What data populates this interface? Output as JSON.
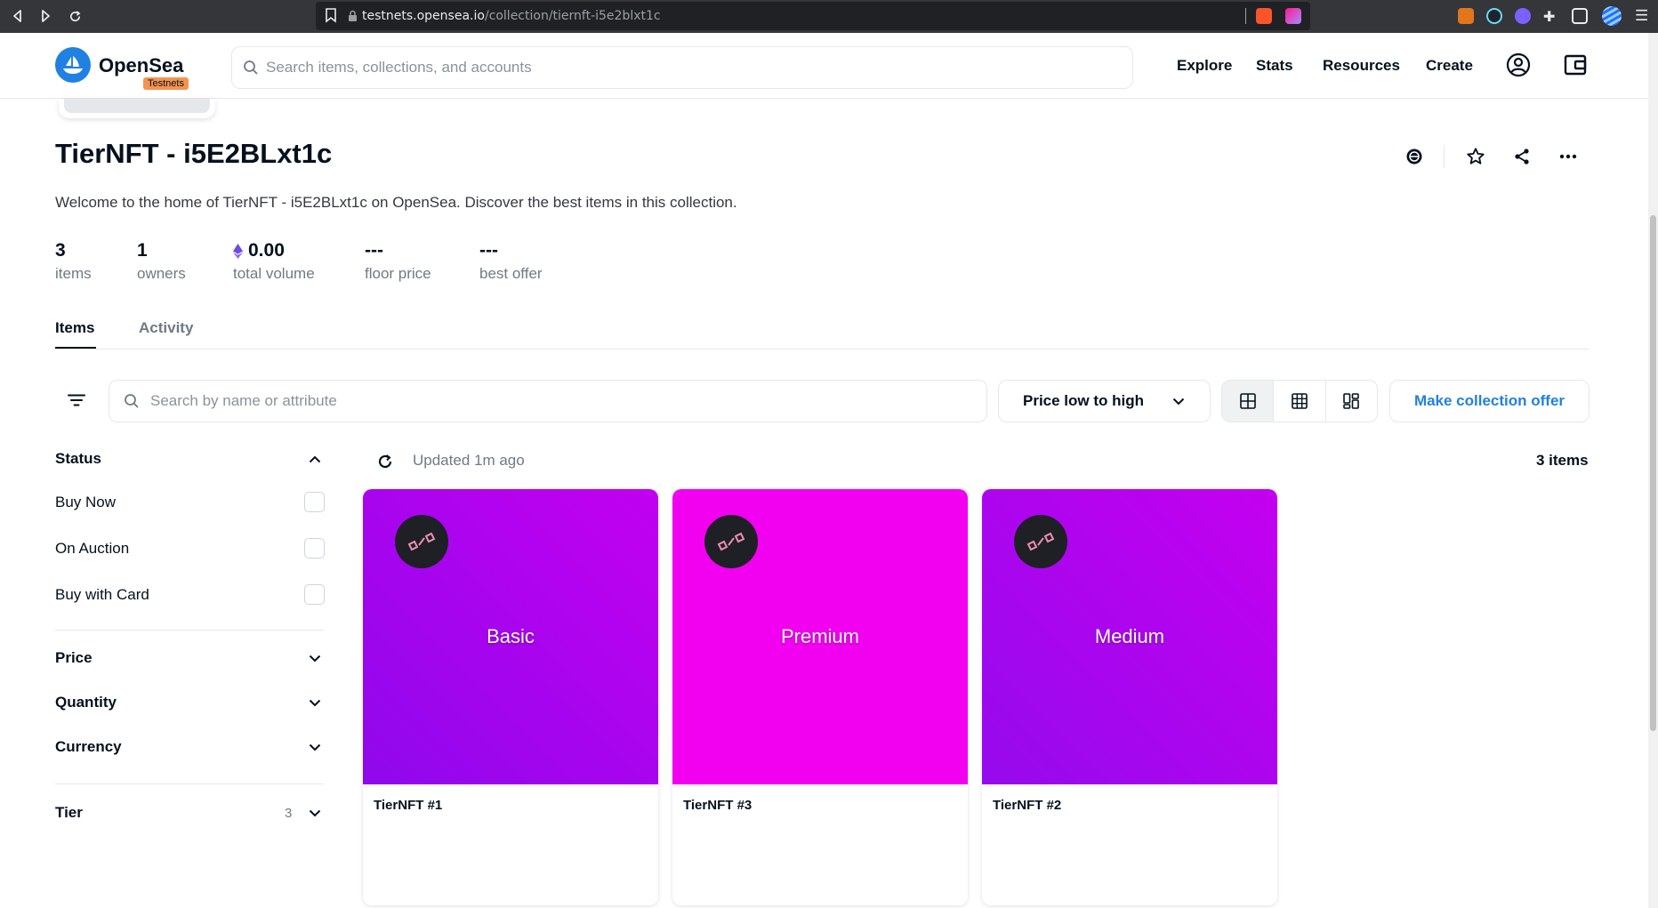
{
  "browser": {
    "url_host": "testnets.opensea.io",
    "url_path": "/collection/tiernft-i5e2blxt1c"
  },
  "header": {
    "logo": "OpenSea",
    "badge": "Testnets",
    "search_placeholder": "Search items, collections, and accounts",
    "nav": [
      "Explore",
      "Stats",
      "Resources",
      "Create"
    ]
  },
  "collection": {
    "title": "TierNFT - i5E2BLxt1c",
    "description": "Welcome to the home of TierNFT - i5E2BLxt1c on OpenSea. Discover the best items in this collection.",
    "stats": [
      {
        "value": "3",
        "label": "items"
      },
      {
        "value": "1",
        "label": "owners"
      },
      {
        "value": "0.00",
        "label": "total volume"
      },
      {
        "value": "---",
        "label": "floor price"
      },
      {
        "value": "---",
        "label": "best offer"
      }
    ]
  },
  "tabs": [
    "Items",
    "Activity"
  ],
  "toolbar": {
    "search_placeholder": "Search by name or attribute",
    "sort_label": "Price low to high",
    "offer_label": "Make collection offer"
  },
  "sidebar": {
    "status_title": "Status",
    "status_options": [
      "Buy Now",
      "On Auction",
      "Buy with Card"
    ],
    "price_title": "Price",
    "quantity_title": "Quantity",
    "currency_title": "Currency",
    "tier_title": "Tier",
    "tier_count": "3"
  },
  "results": {
    "updated": "Updated 1m ago",
    "count": "3 items"
  },
  "cards": [
    {
      "tier": "Basic",
      "name": "TierNFT #1",
      "color": "#9b00f0"
    },
    {
      "tier": "Premium",
      "name": "TierNFT #3",
      "color": "#f200f0"
    },
    {
      "tier": "Medium",
      "name": "TierNFT #2",
      "color": "#a800ee"
    }
  ]
}
